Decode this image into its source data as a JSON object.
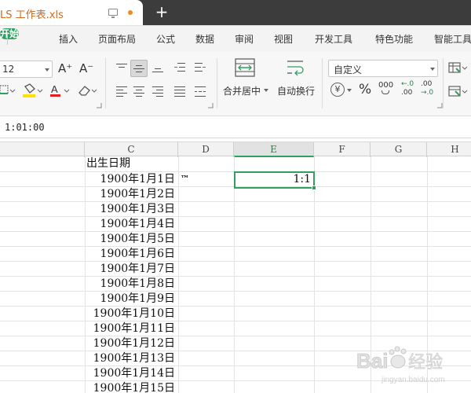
{
  "titlebar": {
    "doc_title": "LS 工作表.xls",
    "new_tab_symbol": "+"
  },
  "menu": {
    "tabs": [
      "开始",
      "插入",
      "页面布局",
      "公式",
      "数据",
      "审阅",
      "视图",
      "开发工具",
      "特色功能",
      "智能工具"
    ]
  },
  "toolbar": {
    "font_size": "12",
    "increase_font": "A⁺",
    "decrease_font": "A⁻",
    "merge_center": "合并居中",
    "wrap_text": "自动换行",
    "number_format": "自定义",
    "percent": "%",
    "thousands": "000",
    "currency_symbol": "¥",
    "inc_decimal_top": "←.0",
    "inc_decimal_bottom": ".00",
    "dec_decimal_top": ".00",
    "dec_decimal_bottom": "→.0"
  },
  "formula_bar": {
    "content": "1:01:00"
  },
  "sheet": {
    "columns": [
      "C",
      "D",
      "E",
      "F",
      "G",
      "H"
    ],
    "selected_column": "E",
    "header_cell": "出生日期",
    "dates": [
      "1900年1月1日",
      "1900年1月2日",
      "1900年1月3日",
      "1900年1月4日",
      "1900年1月5日",
      "1900年1月6日",
      "1900年1月7日",
      "1900年1月8日",
      "1900年1月9日",
      "1900年1月10日",
      "1900年1月11日",
      "1900年1月12日",
      "1900年1月13日",
      "1900年1月14日",
      "1900年1月15日"
    ],
    "d2_value": "™",
    "e2_value": "1:1"
  },
  "watermark": {
    "brand": "Bai",
    "suffix": "经验",
    "sub": "jingyan.baidu.com"
  },
  "colors": {
    "accent": "#2ea160",
    "titlebar": "#3c3c3c",
    "doc_title": "#d2691e"
  }
}
